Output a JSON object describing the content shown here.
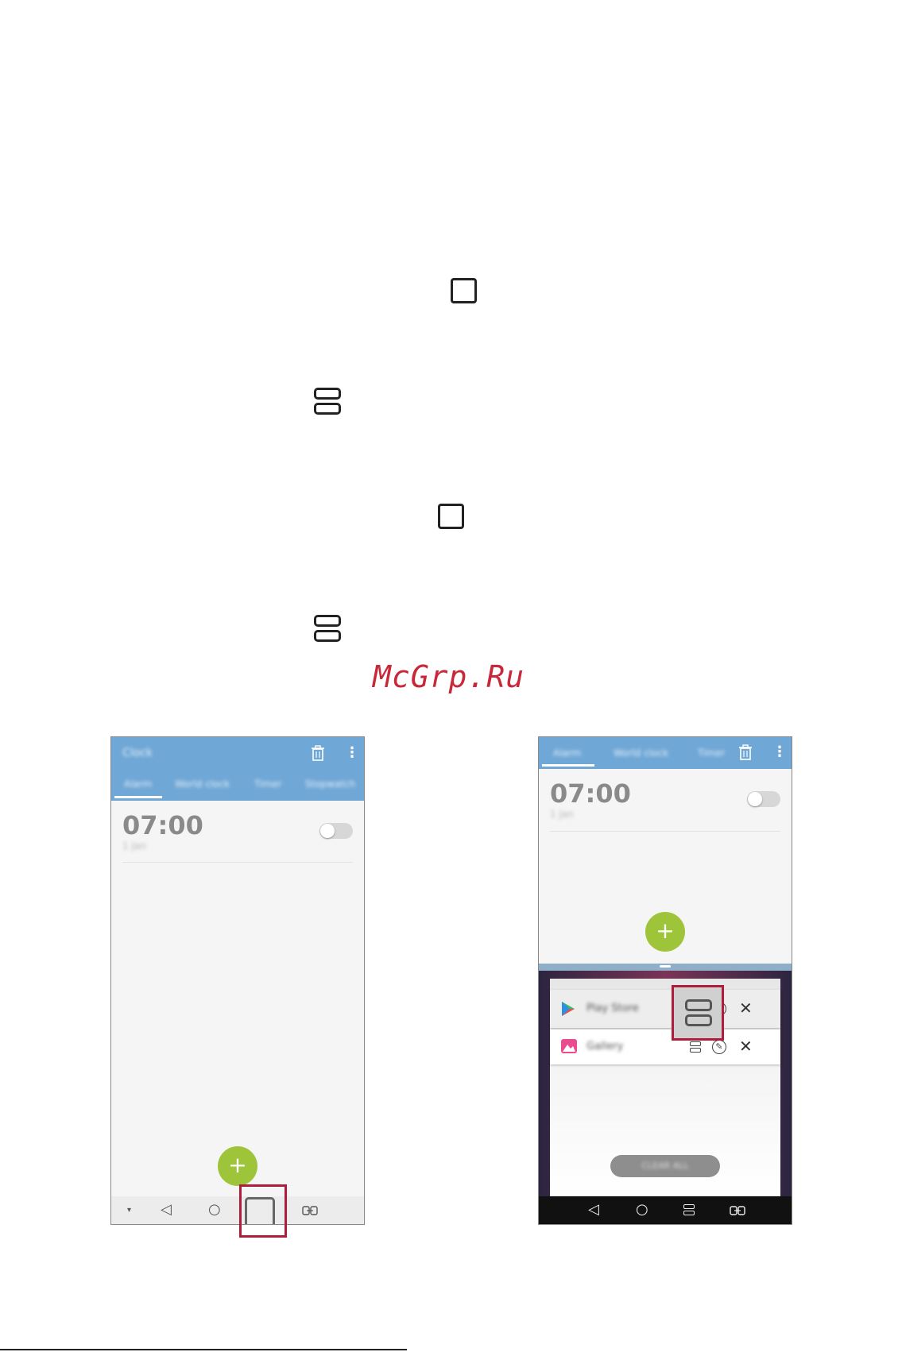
{
  "watermark": "McGrp.Ru",
  "icons": {
    "recent_apps_1": "recent-apps-square-icon",
    "split_1": "split-screen-icon",
    "recent_apps_2": "recent-apps-square-icon",
    "split_2": "split-screen-icon"
  },
  "left_phone": {
    "app_title": "Clock",
    "tabs": [
      "Alarm",
      "World clock",
      "Timer",
      "Stopwatch"
    ],
    "alarm_time": "07:00",
    "alarm_sub": "1 Jan",
    "fab_label": "+",
    "nav": [
      "back-icon",
      "home-icon",
      "recent-apps-icon",
      "dual-window-icon"
    ]
  },
  "right_phone": {
    "tabs": [
      "Alarm",
      "World clock",
      "Timer"
    ],
    "alarm_time": "07:00",
    "alarm_sub": "1 Jan",
    "fab_label": "+",
    "recent_cards": [
      {
        "name": "Play Store"
      },
      {
        "name": "Gallery"
      }
    ],
    "clear_all": "CLEAR ALL"
  },
  "colors": {
    "appbar": "#6fa7d6",
    "fab": "#9ec43a",
    "highlight": "#b01c3c",
    "watermark": "#c8283a"
  }
}
